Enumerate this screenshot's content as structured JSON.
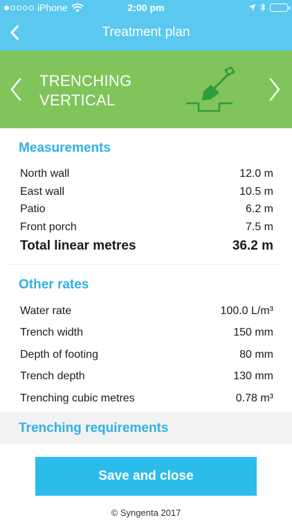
{
  "status_bar": {
    "carrier": "iPhone",
    "time": "2:00 pm",
    "signal_icon": "signal-dots-icon",
    "wifi_icon": "wifi-icon",
    "location_icon": "location-arrow-icon",
    "bluetooth_icon": "bluetooth-icon",
    "battery_icon": "battery-icon"
  },
  "nav": {
    "title": "Treatment plan",
    "back_icon": "chevron-left-icon"
  },
  "banner": {
    "line1": "TRENCHING",
    "line2": "VERTICAL",
    "illustration_icon": "shovel-trench-icon"
  },
  "measurements": {
    "title": "Measurements",
    "rows": [
      {
        "label": "North wall",
        "value": "12.0 m"
      },
      {
        "label": "East wall",
        "value": "10.5 m"
      },
      {
        "label": "Patio",
        "value": "6.2 m"
      },
      {
        "label": "Front porch",
        "value": "7.5 m"
      }
    ],
    "total": {
      "label": "Total linear metres",
      "value": "36.2 m"
    }
  },
  "other_rates": {
    "title": "Other rates",
    "rows": [
      {
        "label": "Water rate",
        "value": "100.0 L/m³"
      },
      {
        "label": "Trench width",
        "value": "150 mm"
      },
      {
        "label": "Depth of footing",
        "value": "80 mm"
      },
      {
        "label": "Trench depth",
        "value": "130 mm"
      },
      {
        "label": "Trenching cubic metres",
        "value": "0.78 m³"
      }
    ]
  },
  "requirements": {
    "title": "Trenching requirements"
  },
  "footer": {
    "save_label": "Save and close",
    "copyright": "© Syngenta 2017"
  },
  "colors": {
    "nav_bg": "#5bc8f0",
    "banner_bg": "#80c45b",
    "accent": "#2fb1e4",
    "button_bg": "#2bbcec",
    "icon_green": "#2e9c3c"
  }
}
